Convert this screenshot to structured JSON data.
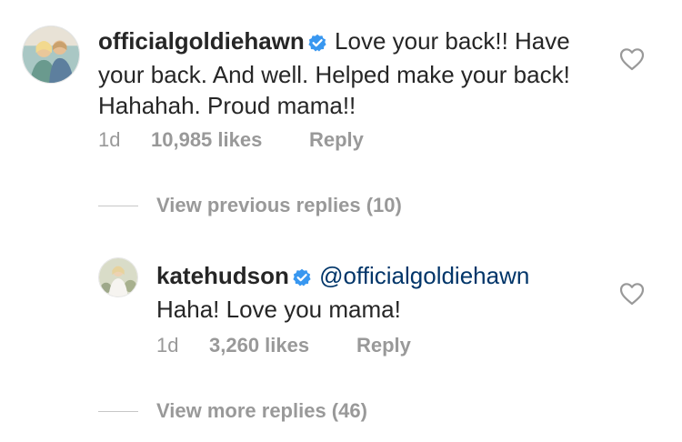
{
  "comments": [
    {
      "username": "officialgoldiehawn",
      "text": "Love your back!! Have your back. And well. Helped make your back! Hahahah. Proud mama!!",
      "time": "1d",
      "likes": "10,985 likes",
      "reply_label": "Reply"
    },
    {
      "username": "katehudson",
      "mention": "@officialgoldiehawn",
      "text": "Haha! Love you mama!",
      "time": "1d",
      "likes": "3,260 likes",
      "reply_label": "Reply"
    }
  ],
  "view_previous_replies": "View previous replies (10)",
  "view_more_replies": "View more replies (46)",
  "colors": {
    "text": "#262626",
    "secondary": "#999999",
    "verified": "#3897f0",
    "mention": "#003569"
  },
  "icons": {
    "verified": "verified-badge-icon",
    "like": "heart-outline-icon"
  }
}
